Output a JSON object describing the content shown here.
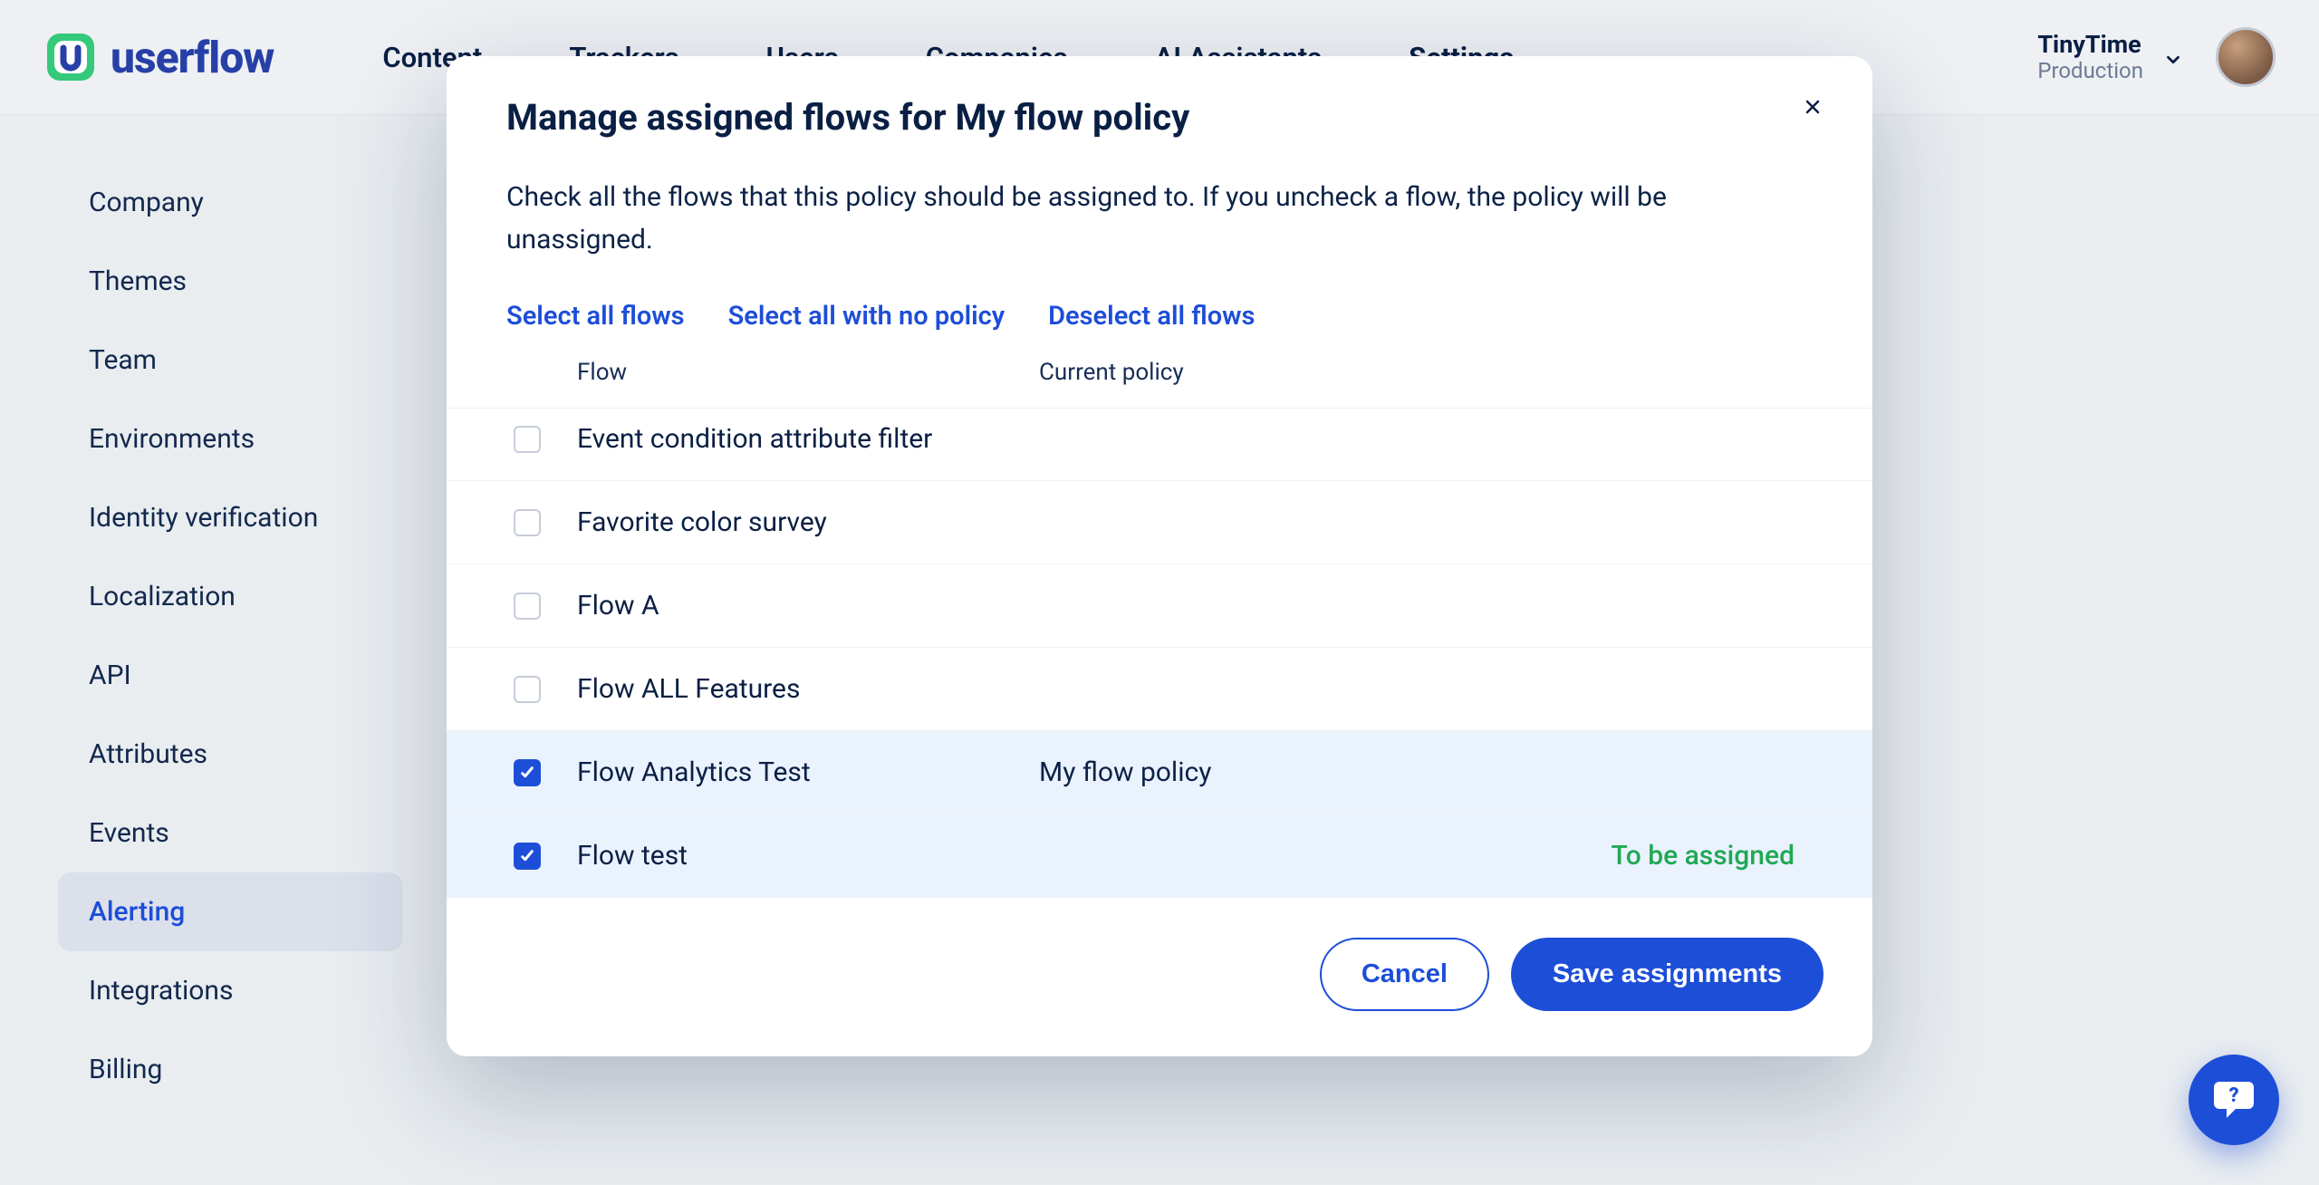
{
  "brand": {
    "name": "userflow"
  },
  "nav": {
    "items": [
      "Content",
      "Trackers",
      "Users",
      "Companies",
      "AI Assistants",
      "Settings"
    ],
    "active_index": 5
  },
  "workspace": {
    "name": "TinyTime",
    "env": "Production"
  },
  "sidebar": {
    "items": [
      "Company",
      "Themes",
      "Team",
      "Environments",
      "Identity verification",
      "Localization",
      "API",
      "Attributes",
      "Events",
      "Alerting",
      "Integrations",
      "Billing"
    ],
    "active_index": 9
  },
  "modal": {
    "title": "Manage assigned flows for My flow policy",
    "description": "Check all the flows that this policy should be assigned to. If you uncheck a flow, the policy will be unassigned.",
    "bulk_actions": {
      "select_all": "Select all flows",
      "select_no_policy": "Select all with no policy",
      "deselect_all": "Deselect all flows"
    },
    "columns": {
      "flow": "Flow",
      "policy": "Current policy"
    },
    "rows": [
      {
        "name": "Event condition attribute filter",
        "policy": "",
        "checked": false,
        "status": ""
      },
      {
        "name": "Favorite color survey",
        "policy": "",
        "checked": false,
        "status": ""
      },
      {
        "name": "Flow A",
        "policy": "",
        "checked": false,
        "status": ""
      },
      {
        "name": "Flow ALL Features",
        "policy": "",
        "checked": false,
        "status": ""
      },
      {
        "name": "Flow Analytics Test",
        "policy": "My flow policy",
        "checked": true,
        "status": ""
      },
      {
        "name": "Flow test",
        "policy": "",
        "checked": true,
        "status": "To be assigned"
      }
    ],
    "footer": {
      "cancel": "Cancel",
      "save": "Save assignments"
    }
  }
}
